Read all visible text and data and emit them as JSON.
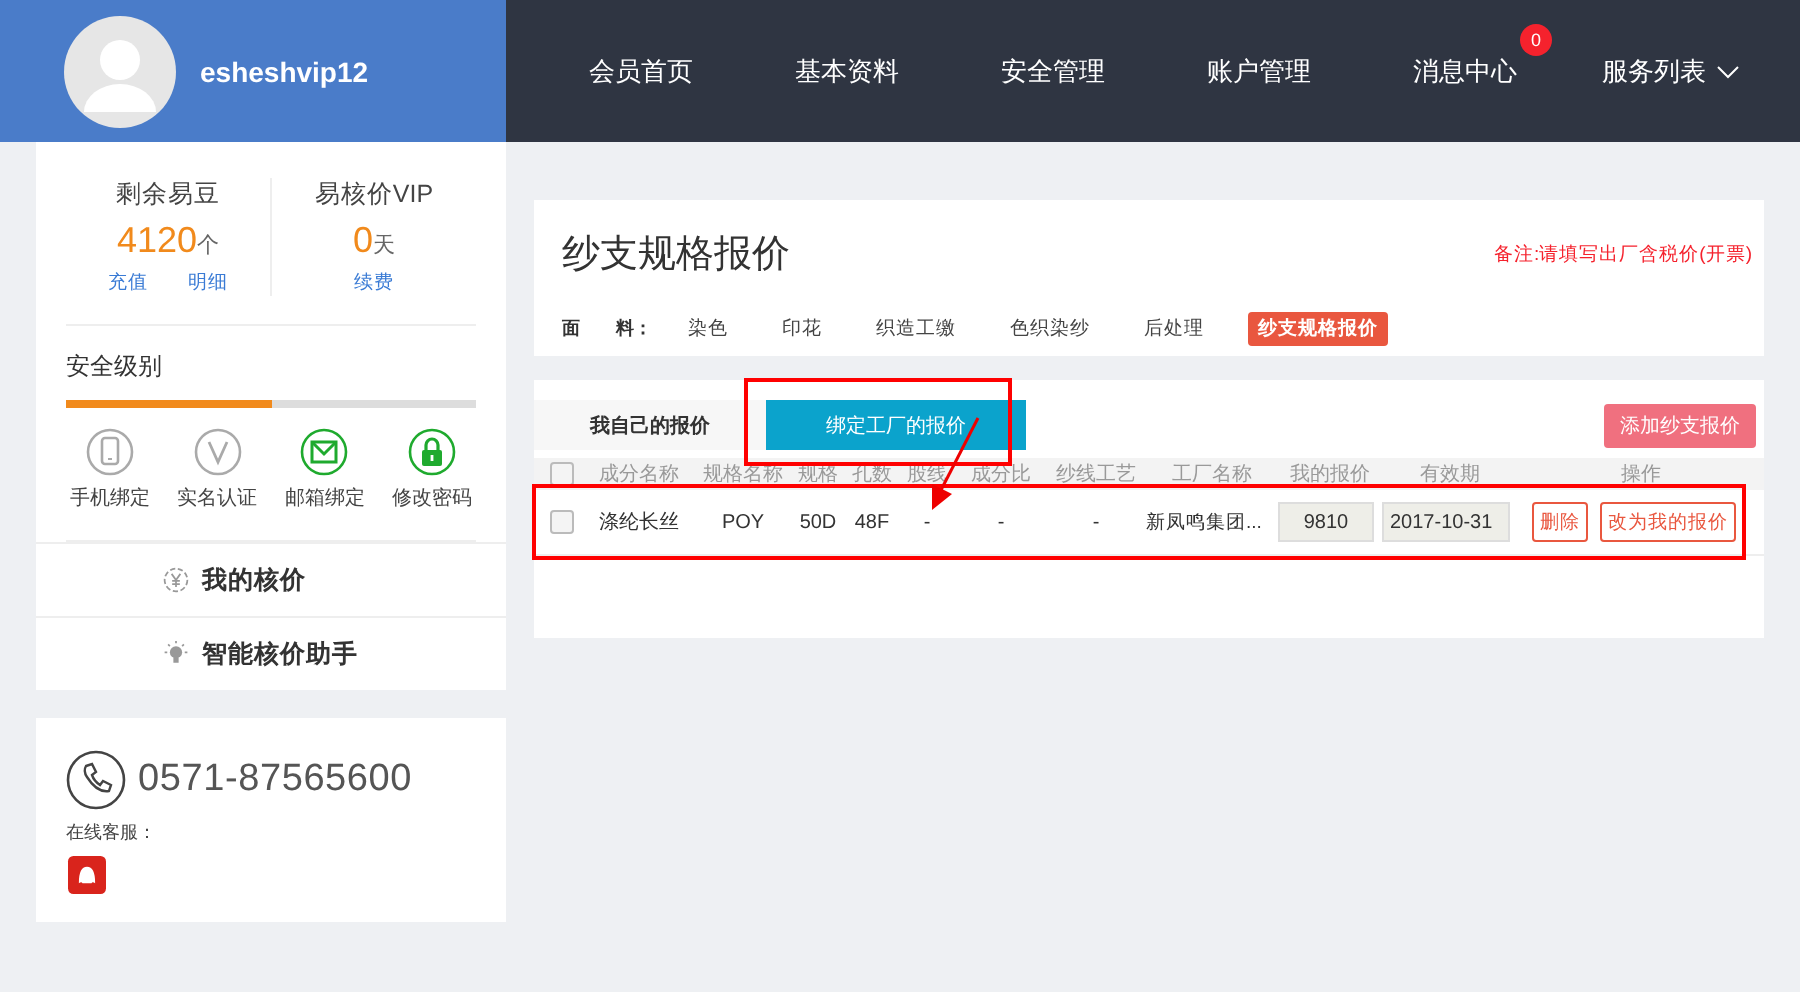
{
  "user": {
    "name": "esheshvip12"
  },
  "nav": [
    {
      "label": "会员首页"
    },
    {
      "label": "基本资料"
    },
    {
      "label": "安全管理"
    },
    {
      "label": "账户管理"
    },
    {
      "label": "消息中心",
      "badge": "0"
    },
    {
      "label": "服务列表",
      "dropdown": true
    }
  ],
  "account": {
    "stats": [
      {
        "title": "剩余易豆",
        "value": "4120",
        "unit": "个",
        "links": [
          "充值",
          "明细"
        ]
      },
      {
        "title": "易核价VIP",
        "value": "0",
        "unit": "天",
        "links": [
          "续费"
        ]
      }
    ],
    "security": {
      "title": "安全级别",
      "level": 0.5,
      "items": [
        {
          "label": "手机绑定",
          "kind": "phone",
          "done": false
        },
        {
          "label": "实名认证",
          "kind": "verify",
          "done": false
        },
        {
          "label": "邮箱绑定",
          "kind": "mail",
          "done": true
        },
        {
          "label": "修改密码",
          "kind": "lock",
          "done": true
        }
      ]
    },
    "menu": [
      {
        "label": "我的核价",
        "kind": "yen"
      },
      {
        "label": "智能核价助手",
        "kind": "bulb"
      }
    ]
  },
  "contact": {
    "phone": "0571-87565600",
    "service_label": "在线客服："
  },
  "page": {
    "title": "纱支规格报价",
    "note": "备注:请填写出厂含税价(开票)",
    "category_label": "面　　料：",
    "categories": [
      {
        "label": "染色",
        "selected": false
      },
      {
        "label": "印花",
        "selected": false
      },
      {
        "label": "织造工缴",
        "selected": false
      },
      {
        "label": "色织染纱",
        "selected": false
      },
      {
        "label": "后处理",
        "selected": false
      },
      {
        "label": "纱支规格报价",
        "selected": true
      }
    ]
  },
  "tabs": [
    {
      "label": "我自己的报价",
      "selected": false
    },
    {
      "label": "绑定工厂的报价",
      "selected": true
    }
  ],
  "add_button": "添加纱支报价",
  "table": {
    "header_checked": false,
    "columns": [
      "成分名称",
      "规格名称",
      "规格",
      "孔数",
      "股线",
      "成分比",
      "纱线工艺",
      "工厂名称",
      "我的报价",
      "有效期",
      "操作"
    ],
    "rows": [
      {
        "checked": false,
        "cells": [
          "涤纶长丝",
          "POY",
          "50D",
          "48F",
          "-",
          "-",
          "-",
          "新凤鸣集团..."
        ],
        "price": "9810",
        "expiry": "2017-10-31",
        "actions": [
          "删除",
          "改为我的报价"
        ]
      }
    ]
  }
}
